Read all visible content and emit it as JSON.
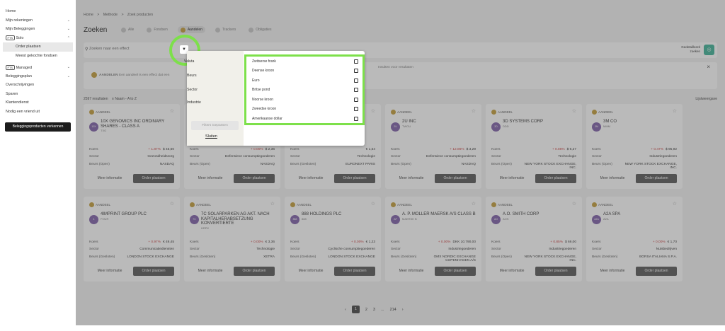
{
  "sidebar": {
    "items": [
      {
        "label": "Home",
        "chevron": ""
      },
      {
        "label": "Mijn rekeningen",
        "chevron": "⌄"
      },
      {
        "label": "Mijn Beleggingen",
        "chevron": "⌄"
      },
      {
        "label": "Solo",
        "chevron": "⌃",
        "pill": "FTS"
      },
      {
        "label": "Order plaatsen",
        "sub": true,
        "active": true
      },
      {
        "label": "Meest gekochte fondsen",
        "sub": true
      },
      {
        "label": "Managed",
        "chevron": "⌄",
        "pill": "FTS"
      },
      {
        "label": "Beleggingsplan",
        "chevron": "⌄"
      },
      {
        "label": "Overschrijvingen",
        "chevron": ""
      },
      {
        "label": "Sparen",
        "chevron": ""
      },
      {
        "label": "Klantendienst",
        "chevron": ""
      },
      {
        "label": "Nodig een vriend uit",
        "chevron": ""
      }
    ],
    "cta": "Beleggingsproducten verkennen"
  },
  "breadcrumb": {
    "home": "Home",
    "sep": ">",
    "methods": "Methode",
    "current": "Zoek producten"
  },
  "page_title": "Zoeken",
  "tabs": [
    {
      "label": "Alle"
    },
    {
      "label": "Fondsen"
    },
    {
      "label": "Aandelen",
      "active": true
    },
    {
      "label": "Trackers"
    },
    {
      "label": "Obligaties"
    }
  ],
  "search": {
    "placeholder": "Zoeken naar een effect",
    "adv_line1": "Gedetailleerd",
    "adv_line2": "zoeken"
  },
  "banner": {
    "tag": "AANDELEN",
    "text": "Een aandeel is een effect dat een",
    "text2": "Insulten voor resultaten"
  },
  "results": {
    "count": "2597 resultaten",
    "sort": "Naam - A to Z",
    "view": "Lijstweergave"
  },
  "filter_panel": {
    "categories": [
      "Valuta",
      "Beurs",
      "Sector",
      "Industrie"
    ],
    "apply": "Filters toepassen",
    "close": "Sluiten",
    "options": [
      "Zwitserse frank",
      "Deense kroon",
      "Euro",
      "Britse pond",
      "Noorse kroon",
      "Zweedse kroon",
      "Amerikaanse dollar"
    ]
  },
  "card_labels": {
    "type": "AANDEEL",
    "koers": "Koers",
    "sector": "Sector",
    "beurs": "Beurs",
    "more": "Meer informatie",
    "order": "Order plaatsen"
  },
  "cards": [
    {
      "name": "10X GENOMICS INC ORDINARY SHARES - CLASS A",
      "ticker": "TXG",
      "logo": "10X",
      "chg": "+ 1.87%",
      "price": "$ 45,60",
      "sector": "Gezondheidszorg",
      "beurs_label": "Beurs (Open)",
      "beurs": "NASDAQ"
    },
    {
      "name": "",
      "ticker": "",
      "logo": "",
      "chg": "+ 0.00%",
      "price": "$ 2,36",
      "sector": "Defensieve consumptiegoederen",
      "beurs_label": "Beurs (Open)",
      "beurs": "NASDAQ"
    },
    {
      "name": "",
      "ticker": "",
      "logo": "",
      "chg": "",
      "price": "€ 1,54",
      "sector": "Technologie",
      "beurs_label": "Beurs (Gesloten)",
      "beurs": "EURONEXT PARIS"
    },
    {
      "name": "2U INC",
      "ticker": "TWOU",
      "logo": "2U",
      "chg": "+ 12.86%",
      "price": "$ 3,29",
      "sector": "Defensieve consumptiegoederen",
      "beurs_label": "Beurs (Open)",
      "beurs": "NASDAQ"
    },
    {
      "name": "3D SYSTEMS CORP",
      "ticker": "DDD",
      "logo": "3D",
      "chg": "+ 0.85%",
      "price": "$ 6,27",
      "sector": "Technologie",
      "beurs_label": "Beurs (Open)",
      "beurs": "NEW YORK STOCK EXCHANGE, INC."
    },
    {
      "name": "3M CO",
      "ticker": "MMM",
      "logo": "3M",
      "chg": "+ 0.47%",
      "price": "$ 95,92",
      "sector": "Industriegoederen",
      "beurs_label": "Beurs (Open)",
      "beurs": "NEW YORK STOCK EXCHANGE, INC."
    },
    {
      "name": "4IMPRINT GROUP PLC",
      "ticker": "FOUR",
      "logo": "4",
      "chg": "+ 0.97%",
      "price": "€ 49,45",
      "sector": "Communicatiediensten",
      "beurs_label": "Beurs (Gesloten)",
      "beurs": "LONDON STOCK EXCHANGE"
    },
    {
      "name": "7C SOLARPARKEN AG AKT. NACH KAPITALHERABSETZUNG KONVERTIERTE",
      "ticker": "HRPK",
      "logo": "7C",
      "chg": "+ 0.00%",
      "price": "€ 3,36",
      "sector": "Technologie",
      "beurs_label": "Beurs (Gesloten)",
      "beurs": "XETRA"
    },
    {
      "name": "888 HOLDINGS PLC",
      "ticker": "888",
      "logo": "888",
      "chg": "+ 0.00%",
      "price": "€ 1,23",
      "sector": "Cyclische consumptiegoederen",
      "beurs_label": "Beurs (Gesloten)",
      "beurs": "LONDON STOCK EXCHANGE"
    },
    {
      "name": "A. P. MOLLER MAERSK A/S CLASS B",
      "ticker": "MAERSK B",
      "logo": "AP",
      "chg": "+ 0.00%",
      "price": "DKK 10.790,00",
      "sector": "Industriegoederen",
      "beurs_label": "Beurs (Gesloten)",
      "beurs": "OMX NORDIC EXCHANGE COPENHAGEN A/S"
    },
    {
      "name": "A.O. SMITH CORP",
      "ticker": "AOS",
      "logo": "AO",
      "chg": "+ 0.85%",
      "price": "$ 69,00",
      "sector": "Industriegoederen",
      "beurs_label": "Beurs (Open)",
      "beurs": "NEW YORK STOCK EXCHANGE, INC."
    },
    {
      "name": "A2A SPA",
      "ticker": "A2A",
      "logo": "A2A",
      "chg": "+ 0.00%",
      "price": "€ 1,70",
      "sector": "Nutsbedrijven",
      "beurs_label": "Beurs (Gesloten)",
      "beurs": "BORSA ITALIANA S.P.A."
    }
  ],
  "pagination": {
    "prev": "‹",
    "p1": "1",
    "p2": "2",
    "p3": "3",
    "dots": "...",
    "last": "214",
    "next": "›"
  },
  "colors": {
    "highlight": "#7de04a",
    "accent": "#4fb8a0",
    "gold": "#c9a64a"
  }
}
